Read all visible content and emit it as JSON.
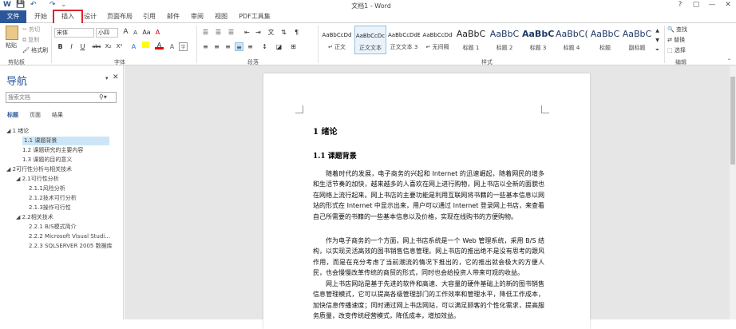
{
  "window": {
    "title": "文档1 - Word",
    "help": "?",
    "restore": "▢",
    "minimize": "—",
    "close": "✕"
  },
  "qat": {
    "word_icon": "W",
    "save": "💾",
    "undo": "↶",
    "redo": "↷",
    "customize": "⌄"
  },
  "tabs": [
    "文件",
    "开始",
    "插入",
    "设计",
    "页面布局",
    "引用",
    "邮件",
    "审阅",
    "视图",
    "PDF工具集"
  ],
  "clipboard": {
    "paste": "粘贴",
    "cut": "剪切",
    "copy": "复制",
    "format_painter": "格式刷",
    "label": "剪贴板"
  },
  "font": {
    "name": "宋体",
    "size": "小四",
    "grow": "A",
    "shrink": "A",
    "case": "Aa",
    "clear": "A",
    "bold": "B",
    "italic": "I",
    "underline": "U",
    "strike": "abc",
    "sub": "X₂",
    "sup": "X²",
    "label": "字体"
  },
  "paragraph": {
    "label": "段落"
  },
  "styles": {
    "items": [
      {
        "preview": "AaBbCcDd",
        "name": "↵ 正文"
      },
      {
        "preview": "AaBbCcDc",
        "name": "正文文本"
      },
      {
        "preview": "AaBbCcDdE",
        "name": "正文文本 3"
      },
      {
        "preview": "AaBbCcDd",
        "name": "↵ 无间隔"
      },
      {
        "preview": "AaBbC",
        "name": "标题 1"
      },
      {
        "preview": "AaBbC",
        "name": "标题 2"
      },
      {
        "preview": "AaBbCb",
        "name": "标题 3"
      },
      {
        "preview": "AaBbC(",
        "name": "标题 4"
      },
      {
        "preview": "AaBbC",
        "name": "标题"
      },
      {
        "preview": "AaBbC",
        "name": "副标题"
      }
    ],
    "label": "样式"
  },
  "editing": {
    "find": "查找",
    "replace": "替换",
    "select": "选择",
    "label": "编辑"
  },
  "nav": {
    "title": "导航",
    "search_placeholder": "搜索文档",
    "tabs": [
      "标题",
      "页面",
      "结果"
    ],
    "tree": [
      {
        "text": "◢ 1 绪论",
        "level": 0,
        "selected": false
      },
      {
        "text": "1.1 课题背景",
        "level": 2,
        "selected": true
      },
      {
        "text": "1.2 课题研究的主要内容",
        "level": 2,
        "selected": false
      },
      {
        "text": "1.3 课题的目的意义",
        "level": 2,
        "selected": false
      },
      {
        "text": "◢ 2可行性分析与相关技术",
        "level": 0,
        "selected": false
      },
      {
        "text": "◢ 2.1可行性分析",
        "level": 1,
        "selected": false
      },
      {
        "text": "2.1.1风险分析",
        "level": 3,
        "selected": false
      },
      {
        "text": "2.1.2技术可行分析",
        "level": 3,
        "selected": false
      },
      {
        "text": "2.1.3操作可行性",
        "level": 3,
        "selected": false
      },
      {
        "text": "◢ 2.2相关技术",
        "level": 1,
        "selected": false
      },
      {
        "text": "2.2.1 B/S模式简介",
        "level": 3,
        "selected": false
      },
      {
        "text": "2.2.2 Microsoft Visual Studi...",
        "level": 3,
        "selected": false
      },
      {
        "text": "2.2.3 SQLSERVER 2005 数据库",
        "level": 3,
        "selected": false
      }
    ]
  },
  "document": {
    "h1": "1    绪论",
    "h2": "1.1  课题背景",
    "paragraphs": [
      "随着时代的发展，电子商务的兴起和 Internet 的迅速崛起，随着网民的增多和生活节奏的加快，越来越多的人喜欢在网上进行购物，网上书店以全新的面貌也在网络上流行起来。网上书店的主要功能是利用互联网将书籍的一些基本信息以网站的形式在 Internet 中显示出来，用户可以通过 Internet 登录网上书店，来查看自己所需要的书籍的一些基本信息以及价格，实现在线购书的方便购物。",
      "作为电子商务的一个方面，网上书店系统是一个 Web 管理系统，采用 B/S 结构，以实现灵活高效的图书销售信息管理。网上书店的推出绝不是没有思考的跟风作用，而是在充分考虑了当前潮流的情况下推出的，它的推出就会极大的方便人民，也会慢慢改革传统的商贸的形式，同时也会给投资人带来可观的收益。",
      "网上书店网站是基于先进的软件和高速、大容量的硬件基础上的新的图书销售信息管理模式，它可以提高各级管理部门的工作效率和管理水平，降低工作成本，加快信息传播速度；同时通过网上书店网站，可以满足顾客的个性化需求，提高服务质量，改变传统经营模式，降低成本，增加效益。"
    ]
  }
}
